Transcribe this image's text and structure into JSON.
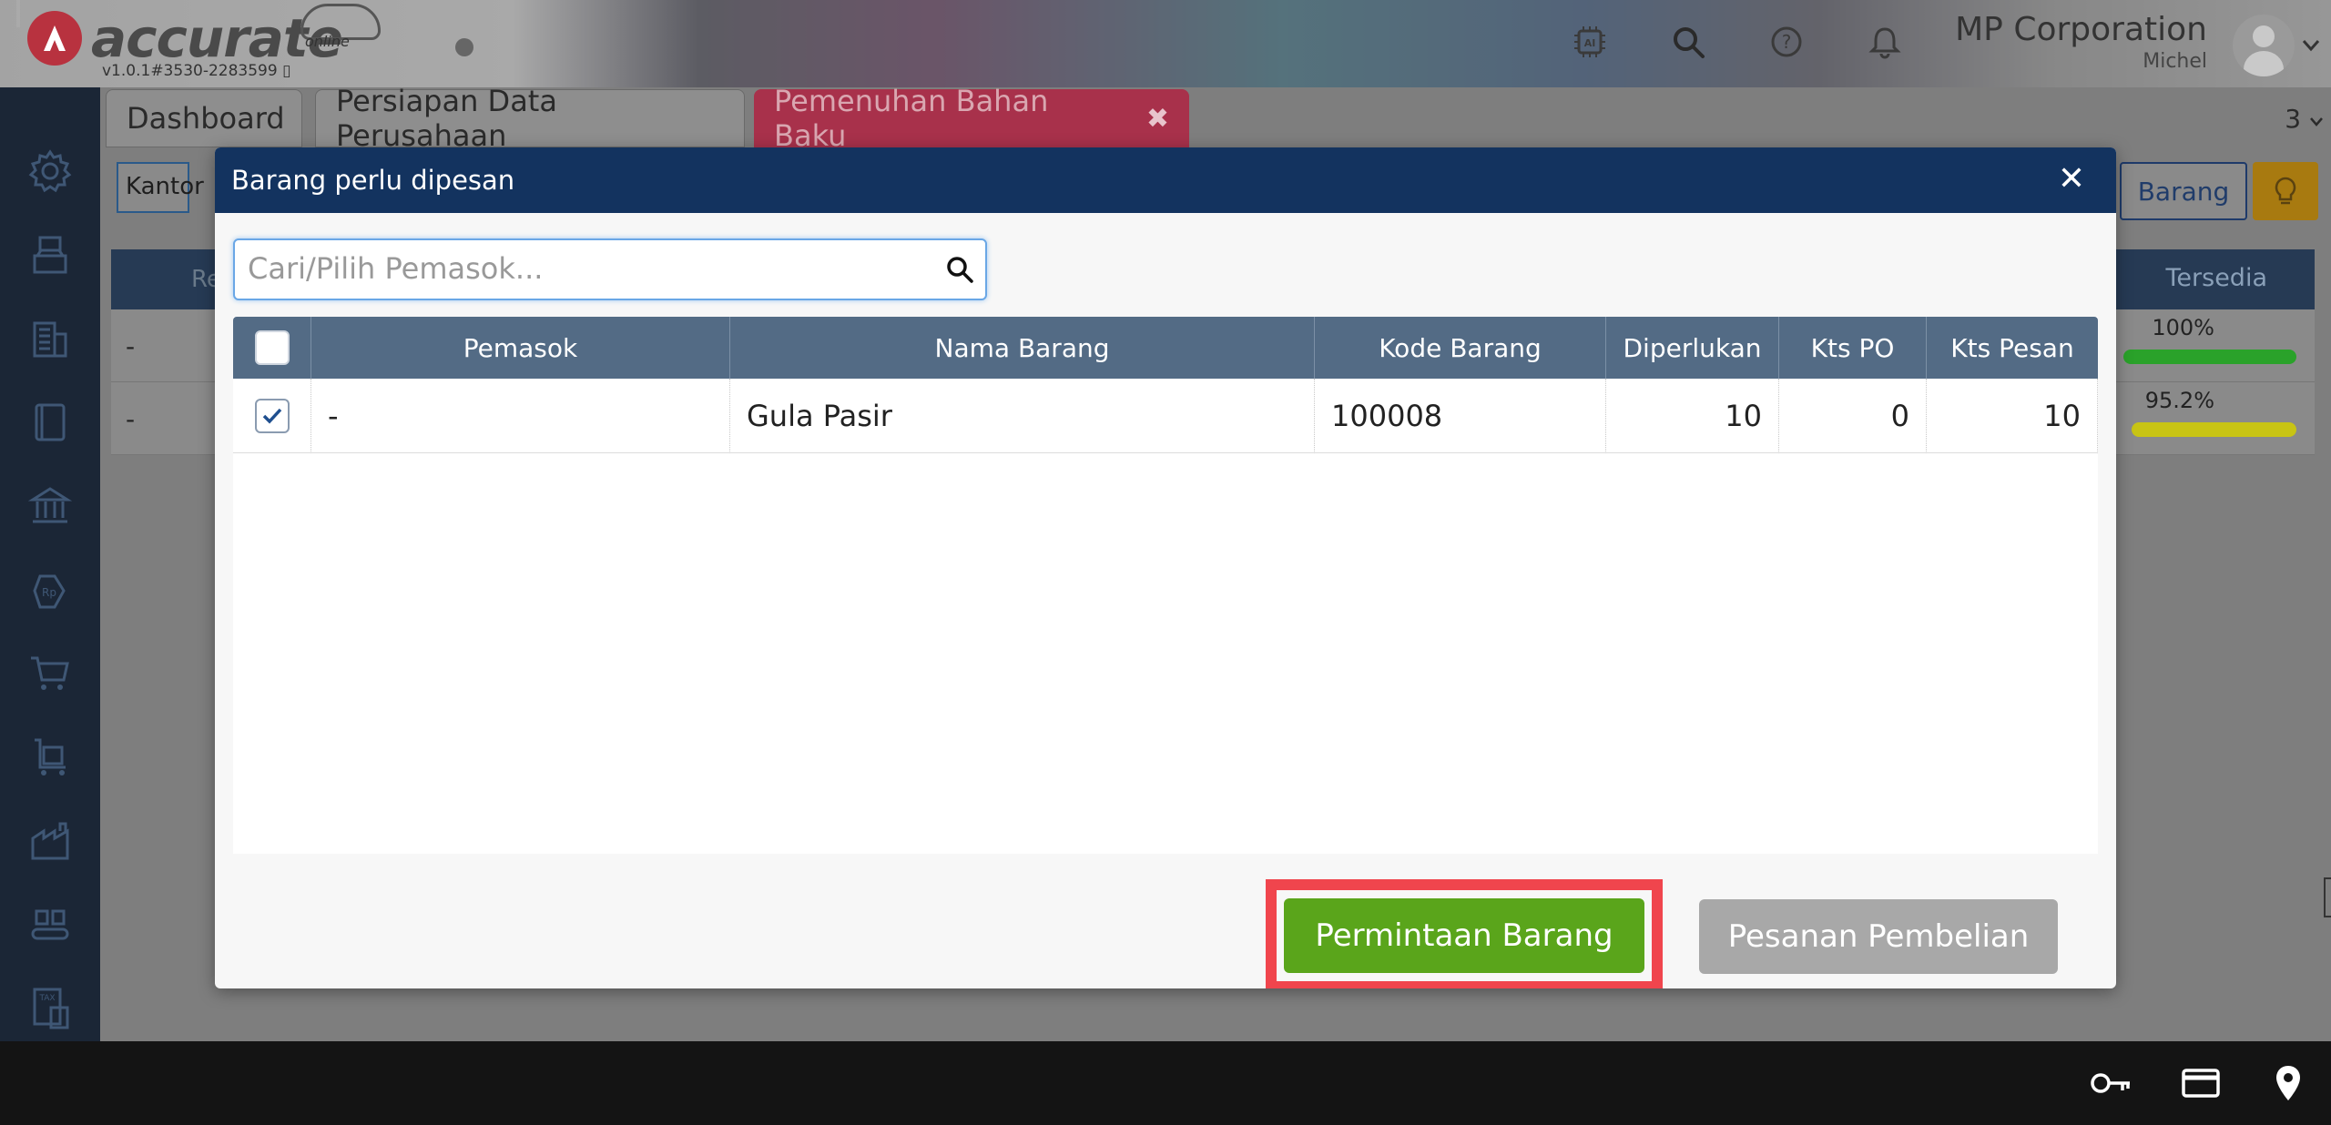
{
  "header": {
    "logo_text": "accurate",
    "logo_sub": "online",
    "version": "v1.0.1#3530-2283599 ▯",
    "company_name": "MP Corporation",
    "user_name": "Michel",
    "icons": [
      "ai-chip-icon",
      "search-icon",
      "help-icon",
      "bell-icon"
    ]
  },
  "tabs": [
    {
      "label": "Dashboard"
    },
    {
      "label": "Persiapan Data Perusahaan"
    },
    {
      "label": "Pemenuhan Bahan Baku",
      "close": "✖"
    }
  ],
  "tab_count": "3",
  "background": {
    "filter_label": "Kantor",
    "barang_button": "Barang",
    "col_re": "Re",
    "col_tersedia": "Tersedia",
    "rows": [
      {
        "dash": "-",
        "pct": "100%",
        "bar_color": "#2aa22a",
        "fill": 1.0
      },
      {
        "dash": "-",
        "pct": "95.2%",
        "bar_color": "#c8c414",
        "fill": 0.952
      }
    ]
  },
  "modal": {
    "title": "Barang perlu dipesan",
    "close": "✕",
    "search_placeholder": "Cari/Pilih Pemasok...",
    "columns": {
      "pemasok": "Pemasok",
      "nama": "Nama Barang",
      "kode": "Kode Barang",
      "diperlukan": "Diperlukan",
      "kts_po": "Kts PO",
      "kts_pesan": "Kts Pesan"
    },
    "rows": [
      {
        "checked": true,
        "pemasok": "-",
        "nama": "Gula Pasir",
        "kode": "100008",
        "diperlukan": "10",
        "kts_po": "0",
        "kts_pesan": "10"
      }
    ],
    "btn_permintaan": "Permintaan Barang",
    "btn_pesanan": "Pesanan Pembelian"
  },
  "colors": {
    "modal_header": "#13335f",
    "grid_header": "#536b85",
    "primary_green": "#5aa51b",
    "highlight_red": "#f0454d"
  }
}
